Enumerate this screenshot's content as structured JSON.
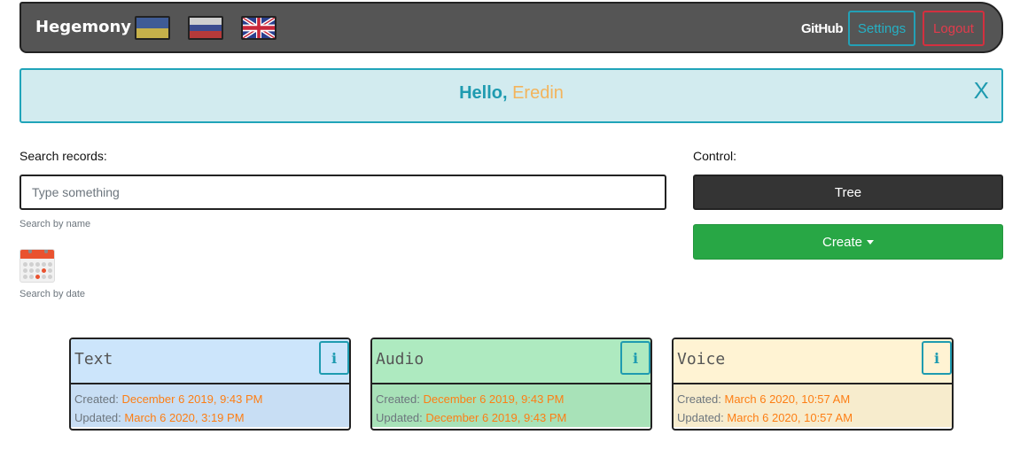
{
  "navbar": {
    "brand": "Hegemony",
    "flags": [
      "ukraine-flag-icon",
      "russia-flag-icon",
      "uk-flag-icon"
    ],
    "github_label": "GitHub",
    "settings_label": "Settings",
    "logout_label": "Logout"
  },
  "alert": {
    "greeting": "Hello,",
    "username": "Eredin",
    "close_label": "X"
  },
  "search": {
    "label": "Search records:",
    "placeholder": "Type something",
    "value": "",
    "hint_name": "Search by name",
    "hint_date": "Search by date"
  },
  "control": {
    "label": "Control:",
    "tree_label": "Tree",
    "create_label": "Create"
  },
  "cards": [
    {
      "title": "Text",
      "info_label": "i",
      "created_label": "Created:",
      "created": "December 6 2019, 9:43 PM",
      "updated_label": "Updated:",
      "updated": "March 6 2020, 3:19 PM"
    },
    {
      "title": "Audio",
      "info_label": "i",
      "created_label": "Created:",
      "created": "December 6 2019, 9:43 PM",
      "updated_label": "Updated:",
      "updated": "December 6 2019, 9:43 PM"
    },
    {
      "title": "Voice",
      "info_label": "i",
      "created_label": "Created:",
      "created": "March 6 2020, 10:57 AM",
      "updated_label": "Updated:",
      "updated": "March 6 2020, 10:57 AM"
    }
  ],
  "colors": {
    "navbar_bg": "#555555",
    "info": "#1f9bb0",
    "danger": "#e23b4c",
    "success": "#28a745",
    "dark": "#343434",
    "accent_orange": "#fd7e14",
    "username_color": "#f3b45c"
  }
}
